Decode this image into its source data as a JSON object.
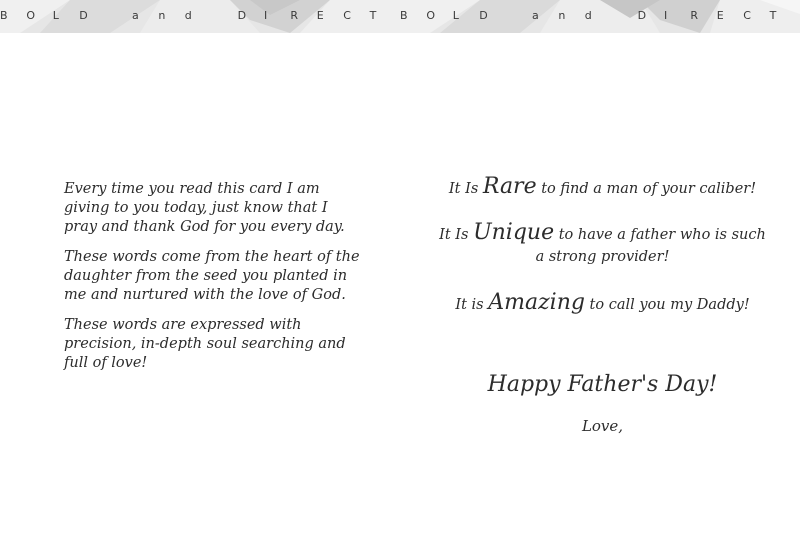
{
  "banner": {
    "left_text": "B O L D   a n d   D I R E C T",
    "right_text": "B O L D   a n d   D I R E C T",
    "colors": {
      "background": "#e6e6e6",
      "shape_dark": "#cfcfcf",
      "shape_light": "#f2f2f2",
      "text": "#3a3a3a"
    }
  },
  "left_page": {
    "paragraphs": [
      "Every time you read this card I am giving to you today, just know that I pray and thank God for you every day.",
      "These words come from the heart of the daughter from the seed you planted in me and nurtured with the love of God.",
      "These words are expressed with precision, in-depth soul searching and full of love!"
    ]
  },
  "right_page": {
    "line1": {
      "prefix": "It Is ",
      "emphasis": "Rare",
      "suffix": " to find a man of your caliber!"
    },
    "line2": {
      "prefix": "It Is ",
      "emphasis": "Unique",
      "suffix": "  to have a father who is such",
      "continuation": "a strong provider!"
    },
    "line3": {
      "prefix": "It is ",
      "emphasis": "Amazing",
      "suffix": "  to call you my Daddy!"
    },
    "greeting": "Happy Father's Day!",
    "signoff": "Love,"
  }
}
